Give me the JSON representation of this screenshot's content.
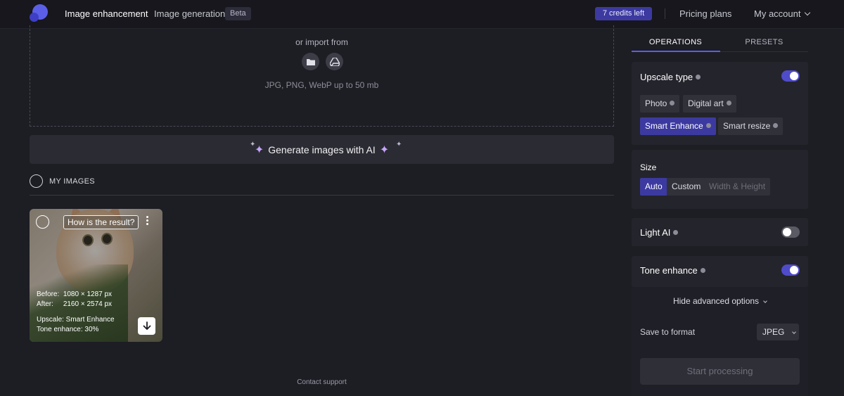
{
  "header": {
    "nav": [
      "Image enhancement",
      "Image generation"
    ],
    "beta_badge": "Beta",
    "credits": "7 credits left",
    "pricing": "Pricing plans",
    "account": "My account"
  },
  "upload": {
    "import_text": "or import from",
    "sources": [
      "folder-icon",
      "google-drive-icon"
    ],
    "formats": "JPG, PNG, WebP up to 50 mb"
  },
  "generate": {
    "label": "Generate images with AI"
  },
  "my_images": {
    "label": "MY IMAGES",
    "cards": [
      {
        "feedback": "How is the result?",
        "before_label": "Before:",
        "before_value": "1080 × 1287 px",
        "after_label": "After:",
        "after_value": "2160 × 2574 px",
        "upscale": "Upscale: Smart Enhance",
        "tone": "Tone enhance: 30%"
      }
    ]
  },
  "footer": {
    "contact": "Contact support"
  },
  "sidebar": {
    "tabs": [
      "OPERATIONS",
      "PRESETS"
    ],
    "active_tab": 0,
    "upscale": {
      "title": "Upscale type",
      "enabled": true,
      "options": [
        "Photo",
        "Digital art",
        "Smart Enhance",
        "Smart resize"
      ],
      "selected": "Smart Enhance"
    },
    "size": {
      "title": "Size",
      "options": [
        "Auto",
        "Custom",
        "Width & Height"
      ],
      "selected": "Auto"
    },
    "light_ai": {
      "title": "Light AI",
      "enabled": false
    },
    "tone_enhance": {
      "title": "Tone enhance",
      "enabled": true
    },
    "advanced": {
      "toggle_label": "Hide advanced options",
      "format_label": "Save to format",
      "format_value": "JPEG"
    },
    "start_button": "Start processing"
  },
  "colors": {
    "accent": "#4f4cc9",
    "selected_chip": "#3c3aa0",
    "background": "#1d1d24"
  }
}
